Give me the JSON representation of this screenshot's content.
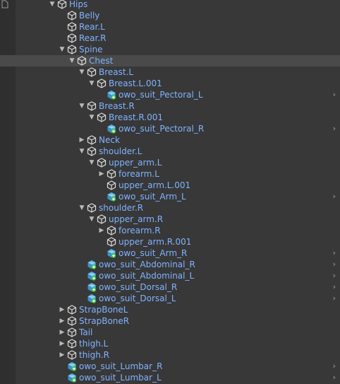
{
  "hierarchy": {
    "rows": [
      {
        "label": "Hips",
        "depth": 0,
        "arrow": "down",
        "icon": "gameobject-icon"
      },
      {
        "label": "Belly",
        "depth": 1,
        "arrow": "none",
        "icon": "gameobject-icon"
      },
      {
        "label": "Rear.L",
        "depth": 1,
        "arrow": "none",
        "icon": "gameobject-icon"
      },
      {
        "label": "Rear.R",
        "depth": 1,
        "arrow": "none",
        "icon": "gameobject-icon"
      },
      {
        "label": "Spine",
        "depth": 1,
        "arrow": "down",
        "icon": "gameobject-icon"
      },
      {
        "label": "Chest",
        "depth": 2,
        "arrow": "down",
        "icon": "gameobject-icon",
        "selected": true
      },
      {
        "label": "Breast.L",
        "depth": 3,
        "arrow": "down",
        "icon": "gameobject-icon"
      },
      {
        "label": "Breast.L.001",
        "depth": 4,
        "arrow": "down",
        "icon": "gameobject-icon"
      },
      {
        "label": "owo_suit_Pectoral_L",
        "depth": 5,
        "arrow": "none",
        "icon": "prefab-icon",
        "more": true
      },
      {
        "label": "Breast.R",
        "depth": 3,
        "arrow": "down",
        "icon": "gameobject-icon"
      },
      {
        "label": "Breast.R.001",
        "depth": 4,
        "arrow": "down",
        "icon": "gameobject-icon"
      },
      {
        "label": "owo_suit_Pectoral_R",
        "depth": 5,
        "arrow": "none",
        "icon": "prefab-icon",
        "more": true
      },
      {
        "label": "Neck",
        "depth": 3,
        "arrow": "right",
        "icon": "gameobject-icon"
      },
      {
        "label": "shoulder.L",
        "depth": 3,
        "arrow": "down",
        "icon": "gameobject-icon"
      },
      {
        "label": "upper_arm.L",
        "depth": 4,
        "arrow": "down",
        "icon": "gameobject-icon"
      },
      {
        "label": "forearm.L",
        "depth": 5,
        "arrow": "right",
        "icon": "gameobject-icon"
      },
      {
        "label": "upper_arm.L.001",
        "depth": 5,
        "arrow": "none",
        "icon": "gameobject-icon"
      },
      {
        "label": "owo_suit_Arm_L",
        "depth": 5,
        "arrow": "none",
        "icon": "prefab-icon",
        "more": true
      },
      {
        "label": "shoulder.R",
        "depth": 3,
        "arrow": "down",
        "icon": "gameobject-icon"
      },
      {
        "label": "upper_arm.R",
        "depth": 4,
        "arrow": "down",
        "icon": "gameobject-icon"
      },
      {
        "label": "forearm.R",
        "depth": 5,
        "arrow": "right",
        "icon": "gameobject-icon"
      },
      {
        "label": "upper_arm.R.001",
        "depth": 5,
        "arrow": "none",
        "icon": "gameobject-icon"
      },
      {
        "label": "owo_suit_Arm_R",
        "depth": 5,
        "arrow": "none",
        "icon": "prefab-icon",
        "more": true
      },
      {
        "label": "owo_suit_Abdominal_R",
        "depth": 3,
        "arrow": "none",
        "icon": "prefab-icon",
        "more": true
      },
      {
        "label": "owo_suit_Abdominal_L",
        "depth": 3,
        "arrow": "none",
        "icon": "prefab-icon",
        "more": true
      },
      {
        "label": "owo_suit_Dorsal_R",
        "depth": 3,
        "arrow": "none",
        "icon": "prefab-icon",
        "more": true
      },
      {
        "label": "owo_suit_Dorsal_L",
        "depth": 3,
        "arrow": "none",
        "icon": "prefab-icon",
        "more": true
      },
      {
        "label": "StrapBoneL",
        "depth": 1,
        "arrow": "right",
        "icon": "gameobject-icon"
      },
      {
        "label": "StrapBoneR",
        "depth": 1,
        "arrow": "right",
        "icon": "gameobject-icon"
      },
      {
        "label": "Tail",
        "depth": 1,
        "arrow": "right",
        "icon": "gameobject-icon"
      },
      {
        "label": "thigh.L",
        "depth": 1,
        "arrow": "right",
        "icon": "gameobject-icon"
      },
      {
        "label": "thigh.R",
        "depth": 1,
        "arrow": "right",
        "icon": "gameobject-icon"
      },
      {
        "label": "owo_suit_Lumbar_R",
        "depth": 1,
        "arrow": "none",
        "icon": "prefab-icon",
        "more": true
      },
      {
        "label": "owo_suit_Lumbar_L",
        "depth": 1,
        "arrow": "none",
        "icon": "prefab-icon",
        "more": true
      }
    ]
  },
  "colors": {
    "background": "#383838",
    "label": "#7fb3ff",
    "prefab": "#58b4e8",
    "prefab_badge": "#3fbf3f"
  }
}
